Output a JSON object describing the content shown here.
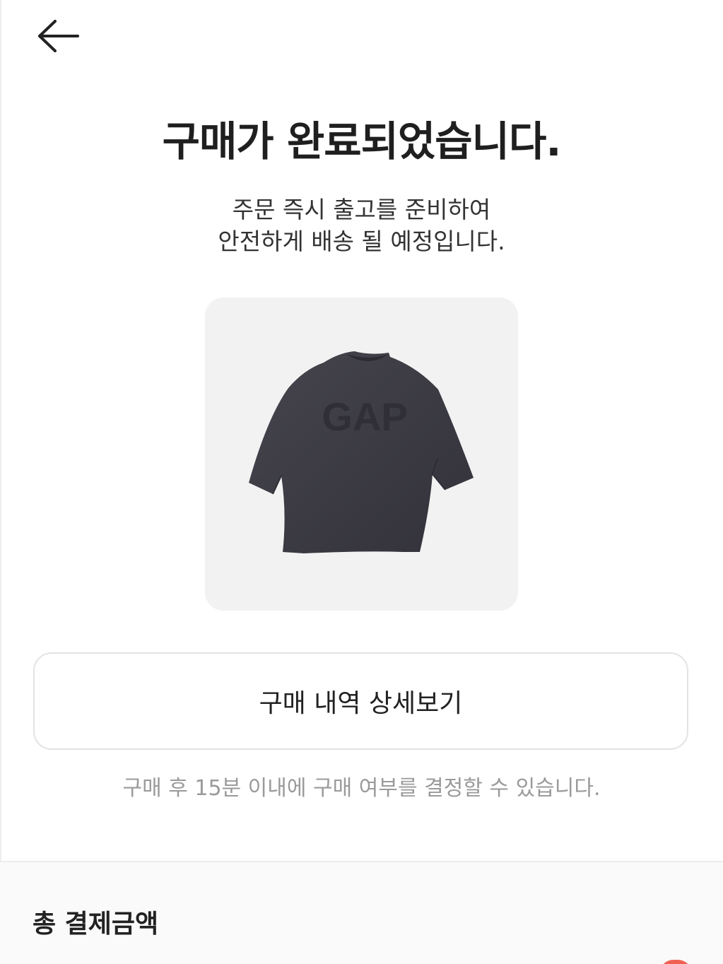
{
  "header": {
    "back_icon": "arrow-left-icon"
  },
  "main": {
    "title": "구매가 완료되었습니다.",
    "subtitle_lines": [
      "주문 즉시 출고를 준비하여",
      "안전하게 배송 될 예정입니다."
    ],
    "product": {
      "image": "product-tshirt-image",
      "print_text": "GAP"
    },
    "detail_button_label": "구매 내역 상세보기",
    "notice": "구매 후 15분 이내에 구매 여부를 결정할 수 있습니다."
  },
  "summary": {
    "total_label": "총 결제금액"
  },
  "colors": {
    "background": "#ffffff",
    "card_background": "#f2f2f2",
    "notice_text": "#9a9a9a",
    "accent": "#ef6253",
    "shirt": "#3c3b43"
  }
}
